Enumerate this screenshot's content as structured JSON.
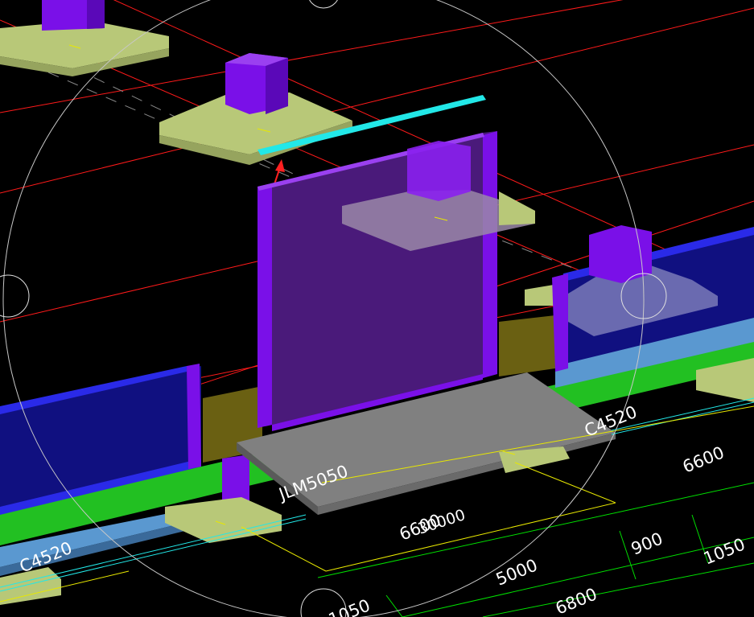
{
  "viewport": {
    "background": "#000000",
    "labels": {
      "c4520_right": "C4520",
      "c4520_left": "C4520",
      "jlm5050": "JLM5050",
      "dim_6600": "6600",
      "dim_6600_over": "6600",
      "dim_30000": "30000",
      "dim_900": "900",
      "dim_1050_right": "1050",
      "dim_5000": "5000",
      "dim_6800": "6800",
      "dim_1050_bottom": "1050"
    }
  },
  "colors": {
    "axis_red": "#ff1a1a",
    "column_purple": "#7a10e8",
    "wall_blue": "#2a2ae8",
    "footing_green": "#b8c878",
    "beam_green": "#22c022",
    "beam_blue": "#5a98d0",
    "slab_gray": "#808080",
    "highlight_cyan": "#22e8e8",
    "dim_green": "#00e000",
    "dim_yellow": "#e8e800",
    "cursor_white": "#e0e0e0",
    "arrow_red": "#ff2020"
  }
}
